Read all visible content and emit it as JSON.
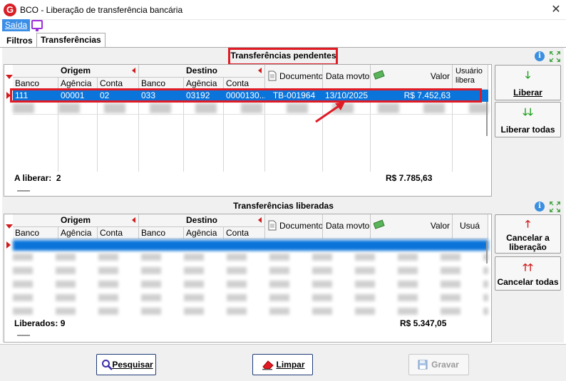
{
  "window": {
    "title": "BCO - Liberação de transferência bancária",
    "close_glyph": "✕",
    "app_icon": "G"
  },
  "menu": {
    "saida": "Saída"
  },
  "tabs": [
    {
      "label": "Filtros"
    },
    {
      "label": "Transferências"
    }
  ],
  "pending": {
    "title": "Transferências pendentes",
    "groups": {
      "origem": "Origem",
      "destino": "Destino"
    },
    "columns": {
      "banco": "Banco",
      "agencia": "Agência",
      "conta": "Conta",
      "banco2": "Banco",
      "agencia2": "Agência",
      "conta2": "Conta",
      "documento": "Documento",
      "data_movto": "Data movto",
      "valor": "Valor",
      "usuario": "Usuário libera"
    },
    "selected_row": {
      "banco": "111",
      "agencia": "00001",
      "conta": "02",
      "banco2": "033",
      "agencia2": "03192",
      "conta2": "0000130...",
      "documento": "TB-001964",
      "data_movto": "13/10/2025",
      "valor": "R$ 7.452,63"
    },
    "footer": {
      "label": "A liberar:",
      "count": "2",
      "total": "R$ 7.785,63"
    }
  },
  "released": {
    "title": "Transferências liberadas",
    "groups": {
      "origem": "Origem",
      "destino": "Destino"
    },
    "columns": {
      "banco": "Banco",
      "agencia": "Agência",
      "conta": "Conta",
      "banco2": "Banco",
      "agencia2": "Agência",
      "conta2": "Conta",
      "documento": "Documento",
      "data_movto": "Data movto",
      "valor": "Valor",
      "usuario": "Usuá"
    },
    "footer": {
      "label": "Liberados:",
      "count": "9",
      "total": "R$ 5.347,05"
    }
  },
  "side_buttons": {
    "liberar": "Liberar",
    "liberar_todas": "Liberar todas",
    "cancelar_liberacao_1": "Cancelar a",
    "cancelar_liberacao_2": "liberação",
    "cancelar_todas": "Cancelar todas"
  },
  "bottom_buttons": {
    "pesquisar": "Pesquisar",
    "limpar": "Limpar",
    "gravar": "Gravar"
  },
  "colors": {
    "selection": "#0a74da",
    "highlight": "#e01b24",
    "accent_green": "#1ea01e",
    "accent_red": "#d01c1c"
  }
}
